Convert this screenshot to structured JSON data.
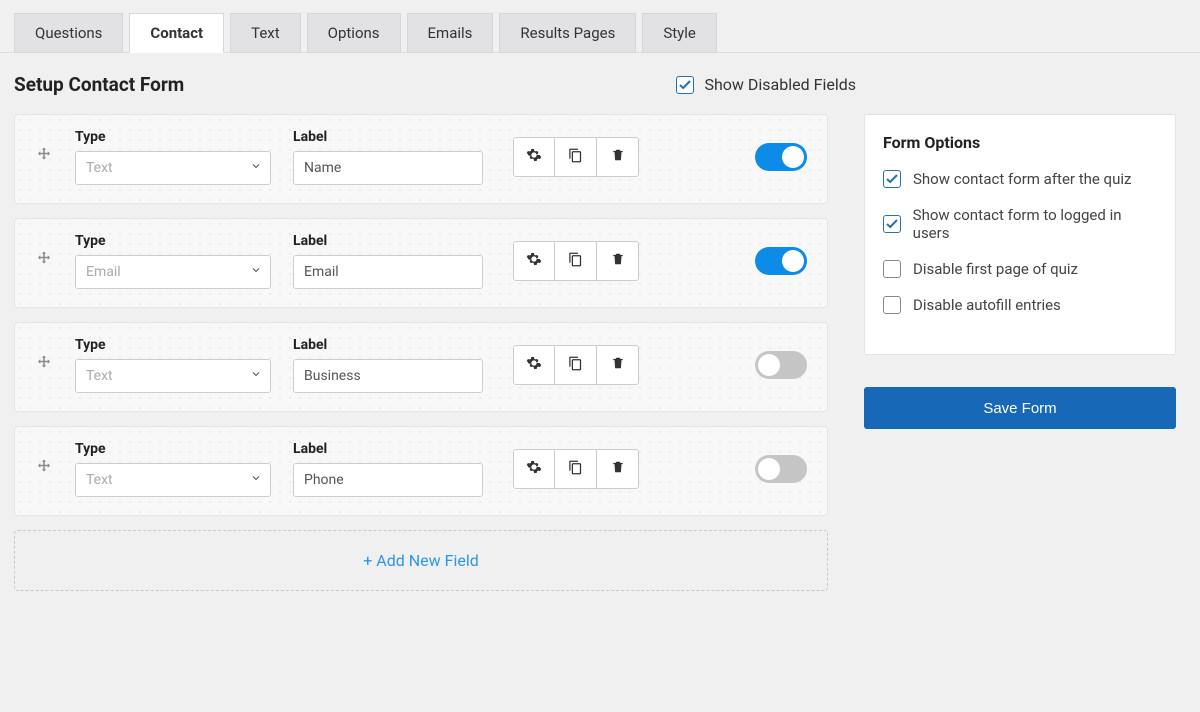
{
  "tabs": [
    "Questions",
    "Contact",
    "Text",
    "Options",
    "Emails",
    "Results Pages",
    "Style"
  ],
  "active_tab_index": 1,
  "page_title": "Setup Contact Form",
  "show_disabled_label": "Show Disabled Fields",
  "show_disabled_checked": true,
  "col_headers": {
    "type": "Type",
    "label": "Label"
  },
  "fields": [
    {
      "type": "Text",
      "label": "Name",
      "enabled": true
    },
    {
      "type": "Email",
      "label": "Email",
      "enabled": true
    },
    {
      "type": "Text",
      "label": "Business",
      "enabled": false
    },
    {
      "type": "Text",
      "label": "Phone",
      "enabled": false
    }
  ],
  "add_new_label": "+ Add New Field",
  "side": {
    "title": "Form Options",
    "options": [
      {
        "label": "Show contact form after the quiz",
        "checked": true
      },
      {
        "label": "Show contact form to logged in users",
        "checked": true
      },
      {
        "label": "Disable first page of quiz",
        "checked": false
      },
      {
        "label": "Disable autofill entries",
        "checked": false
      }
    ],
    "save_label": "Save Form"
  }
}
